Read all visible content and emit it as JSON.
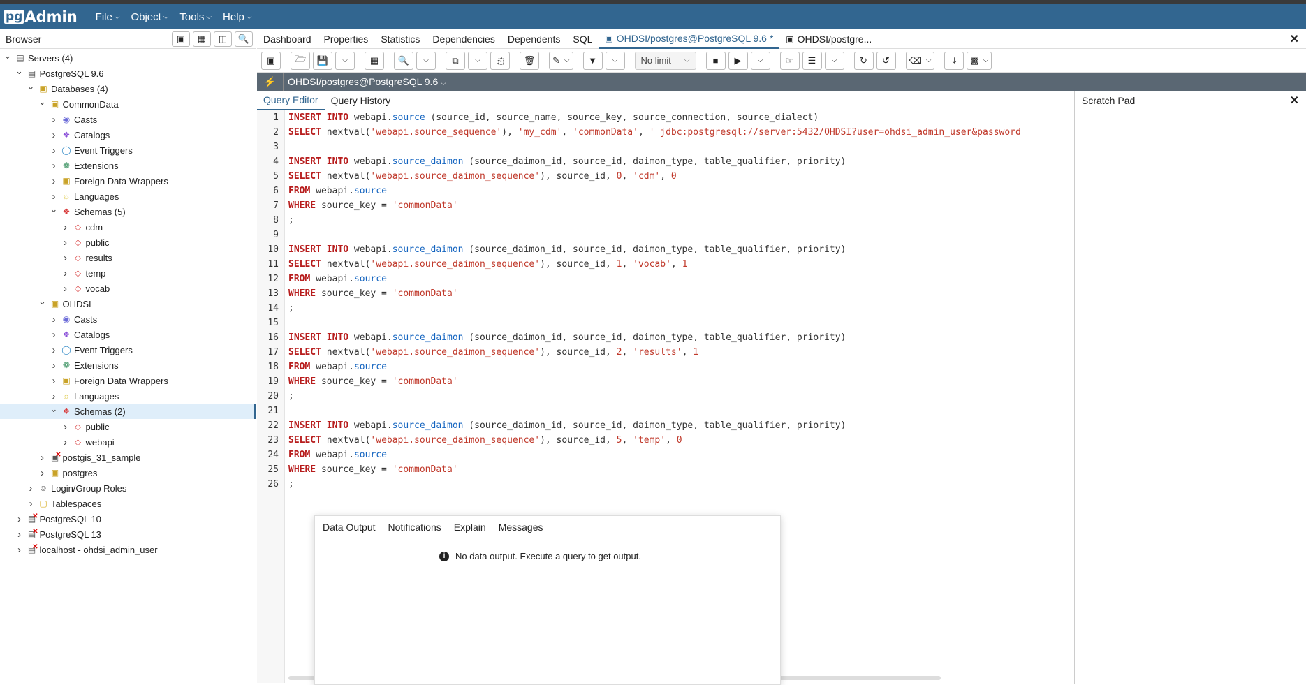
{
  "app": {
    "brand_pg": "pg",
    "brand_admin": "Admin"
  },
  "menubar": [
    {
      "label": "File"
    },
    {
      "label": "Object"
    },
    {
      "label": "Tools"
    },
    {
      "label": "Help"
    }
  ],
  "browser": {
    "title": "Browser",
    "tree": [
      {
        "label": "Servers (4)",
        "depth": 0,
        "chev": "v",
        "icon": "servers-icon"
      },
      {
        "label": "PostgreSQL 9.6",
        "depth": 1,
        "chev": "v",
        "icon": "server-icon"
      },
      {
        "label": "Databases (4)",
        "depth": 2,
        "chev": "v",
        "icon": "databases-icon"
      },
      {
        "label": "CommonData",
        "depth": 3,
        "chev": "v",
        "icon": "database-icon"
      },
      {
        "label": "Casts",
        "depth": 4,
        "chev": ">",
        "icon": "casts-icon"
      },
      {
        "label": "Catalogs",
        "depth": 4,
        "chev": ">",
        "icon": "catalogs-icon"
      },
      {
        "label": "Event Triggers",
        "depth": 4,
        "chev": ">",
        "icon": "event-triggers-icon"
      },
      {
        "label": "Extensions",
        "depth": 4,
        "chev": ">",
        "icon": "extensions-icon"
      },
      {
        "label": "Foreign Data Wrappers",
        "depth": 4,
        "chev": ">",
        "icon": "fdw-icon"
      },
      {
        "label": "Languages",
        "depth": 4,
        "chev": ">",
        "icon": "languages-icon"
      },
      {
        "label": "Schemas (5)",
        "depth": 4,
        "chev": "v",
        "icon": "schemas-icon"
      },
      {
        "label": "cdm",
        "depth": 5,
        "chev": ">",
        "icon": "schema-icon"
      },
      {
        "label": "public",
        "depth": 5,
        "chev": ">",
        "icon": "schema-icon"
      },
      {
        "label": "results",
        "depth": 5,
        "chev": ">",
        "icon": "schema-icon"
      },
      {
        "label": "temp",
        "depth": 5,
        "chev": ">",
        "icon": "schema-icon"
      },
      {
        "label": "vocab",
        "depth": 5,
        "chev": ">",
        "icon": "schema-icon"
      },
      {
        "label": "OHDSI",
        "depth": 3,
        "chev": "v",
        "icon": "database-icon"
      },
      {
        "label": "Casts",
        "depth": 4,
        "chev": ">",
        "icon": "casts-icon"
      },
      {
        "label": "Catalogs",
        "depth": 4,
        "chev": ">",
        "icon": "catalogs-icon"
      },
      {
        "label": "Event Triggers",
        "depth": 4,
        "chev": ">",
        "icon": "event-triggers-icon"
      },
      {
        "label": "Extensions",
        "depth": 4,
        "chev": ">",
        "icon": "extensions-icon"
      },
      {
        "label": "Foreign Data Wrappers",
        "depth": 4,
        "chev": ">",
        "icon": "fdw-icon"
      },
      {
        "label": "Languages",
        "depth": 4,
        "chev": ">",
        "icon": "languages-icon"
      },
      {
        "label": "Schemas (2)",
        "depth": 4,
        "chev": "v",
        "icon": "schemas-icon",
        "selected": true
      },
      {
        "label": "public",
        "depth": 5,
        "chev": ">",
        "icon": "schema-icon"
      },
      {
        "label": "webapi",
        "depth": 5,
        "chev": ">",
        "icon": "schema-icon"
      },
      {
        "label": "postgis_31_sample",
        "depth": 3,
        "chev": ">",
        "icon": "database-disconnected-icon"
      },
      {
        "label": "postgres",
        "depth": 3,
        "chev": ">",
        "icon": "database-icon"
      },
      {
        "label": "Login/Group Roles",
        "depth": 2,
        "chev": ">",
        "icon": "roles-icon"
      },
      {
        "label": "Tablespaces",
        "depth": 2,
        "chev": ">",
        "icon": "tablespaces-icon"
      },
      {
        "label": "PostgreSQL 10",
        "depth": 1,
        "chev": ">",
        "icon": "server-disconnected-icon"
      },
      {
        "label": "PostgreSQL 13",
        "depth": 1,
        "chev": ">",
        "icon": "server-disconnected-icon"
      },
      {
        "label": "localhost - ohdsi_admin_user",
        "depth": 1,
        "chev": ">",
        "icon": "server-disconnected-icon"
      }
    ]
  },
  "tabs": [
    {
      "label": "Dashboard"
    },
    {
      "label": "Properties"
    },
    {
      "label": "Statistics"
    },
    {
      "label": "Dependencies"
    },
    {
      "label": "Dependents"
    },
    {
      "label": "SQL"
    },
    {
      "label": "OHDSI/postgres@PostgreSQL 9.6 *",
      "active": true,
      "icon": "query-tool-icon"
    },
    {
      "label": "OHDSI/postgre...",
      "icon": "query-tool-icon"
    }
  ],
  "toolbar": {
    "limit_label": "No limit"
  },
  "connection": {
    "label": "OHDSI/postgres@PostgreSQL 9.6"
  },
  "query_tabs": [
    {
      "label": "Query Editor",
      "active": true
    },
    {
      "label": "Query History"
    }
  ],
  "scratch_pad": {
    "title": "Scratch Pad"
  },
  "editor": {
    "lines": [
      "INSERT INTO webapi.source (source_id, source_name, source_key, source_connection, source_dialect)",
      "SELECT nextval('webapi.source_sequence'), 'my_cdm', 'commonData', ' jdbc:postgresql://server:5432/OHDSI?user=ohdsi_admin_user&password",
      "",
      "INSERT INTO webapi.source_daimon (source_daimon_id, source_id, daimon_type, table_qualifier, priority)",
      "SELECT nextval('webapi.source_daimon_sequence'), source_id, 0, 'cdm', 0",
      "FROM webapi.source",
      "WHERE source_key = 'commonData'",
      ";",
      "",
      "INSERT INTO webapi.source_daimon (source_daimon_id, source_id, daimon_type, table_qualifier, priority)",
      "SELECT nextval('webapi.source_daimon_sequence'), source_id, 1, 'vocab', 1",
      "FROM webapi.source",
      "WHERE source_key = 'commonData'",
      ";",
      "",
      "INSERT INTO webapi.source_daimon (source_daimon_id, source_id, daimon_type, table_qualifier, priority)",
      "SELECT nextval('webapi.source_daimon_sequence'), source_id, 2, 'results', 1",
      "FROM webapi.source",
      "WHERE source_key = 'commonData'",
      ";",
      "",
      "INSERT INTO webapi.source_daimon (source_daimon_id, source_id, daimon_type, table_qualifier, priority)",
      "SELECT nextval('webapi.source_daimon_sequence'), source_id, 5, 'temp', 0",
      "FROM webapi.source",
      "WHERE source_key = 'commonData'",
      ";"
    ]
  },
  "output": {
    "tabs": [
      {
        "label": "Data Output",
        "active": true
      },
      {
        "label": "Notifications"
      },
      {
        "label": "Explain"
      },
      {
        "label": "Messages"
      }
    ],
    "message": "No data output. Execute a query to get output."
  },
  "colors": {
    "navbar": "#326690",
    "accent": "#326690",
    "selected_row": "#dfeefa"
  }
}
